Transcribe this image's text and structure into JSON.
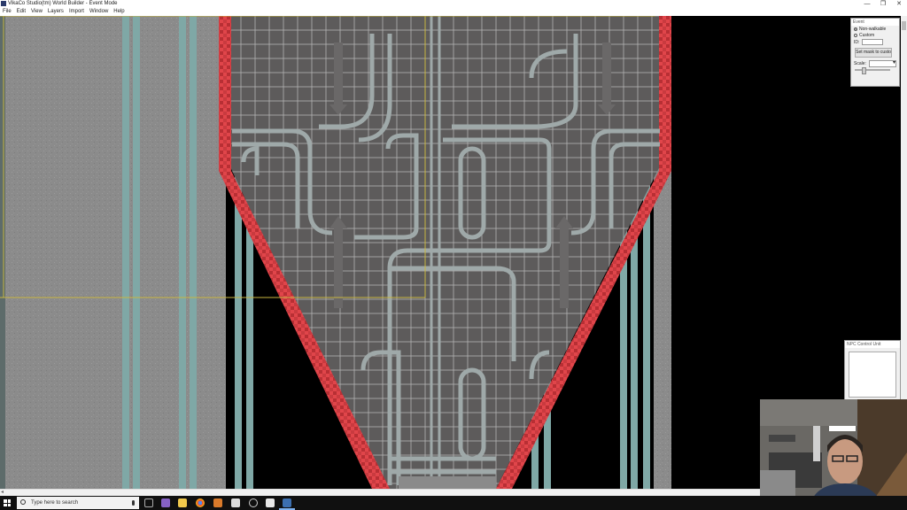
{
  "window": {
    "title": "VikaCo Studio(tm) World Builder - Event Mode",
    "minimize_glyph": "—",
    "maximize_glyph": "❐",
    "close_glyph": "✕"
  },
  "menu": [
    "File",
    "Edit",
    "View",
    "Layers",
    "Import",
    "Window",
    "Help"
  ],
  "event_panel": {
    "title": "Event",
    "radio_options": [
      "Non-walkable",
      "Custom"
    ],
    "selected_option": "Non-walkable",
    "id_label": "ID:",
    "id_value": "",
    "button_label": "Set mask to custo",
    "scale_label": "Scale:",
    "scale_value": ""
  },
  "npc_panel": {
    "title": "NPC Control Unit"
  },
  "taskbar": {
    "search_placeholder": "Type here to search",
    "pinned_icons": [
      "windows-start-icon",
      "visual-studio-icon",
      "file-explorer-icon",
      "chrome-icon",
      "paint-icon",
      "apps-icon",
      "settings-icon",
      "world-builder-icon",
      "vika-icon"
    ]
  },
  "colors": {
    "canvas_floor": "#5d5b5b",
    "grid_line": "#bdbdbd",
    "pipe": "#9fa9a9",
    "edge_red": "#e0454a",
    "wall_grey": "#8a8a8a",
    "stripe_teal": "#7fa8a6",
    "guide_yellow": "#c8b640",
    "taskbar_bg": "#101010"
  }
}
